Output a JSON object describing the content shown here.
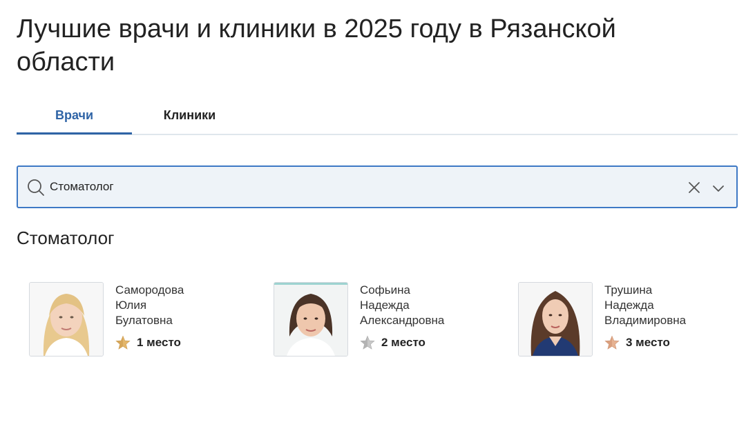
{
  "page": {
    "title": "Лучшие врачи и клиники в 2025 году в Рязанской области"
  },
  "tabs": [
    {
      "label": "Врачи",
      "active": true
    },
    {
      "label": "Клиники",
      "active": false
    }
  ],
  "search": {
    "value": "Стоматолог",
    "icons": {
      "search": "search-icon",
      "clear": "close-icon",
      "expand": "chevron-down-icon"
    }
  },
  "section": {
    "title": "Стоматолог"
  },
  "doctors": [
    {
      "last_name": "Самородова",
      "first_name": "Юлия",
      "patronymic": "Булатовна",
      "rank": "1 место",
      "medal_color": "#e3b66b"
    },
    {
      "last_name": "Софьина",
      "first_name": "Надежда",
      "patronymic": "Александровна",
      "rank": "2 место",
      "medal_color": "#bdbdbd"
    },
    {
      "last_name": "Трушина",
      "first_name": "Надежда",
      "patronymic": "Владимировна",
      "rank": "3 место",
      "medal_color": "#e6b292"
    }
  ],
  "colors": {
    "accent": "#2f64a6",
    "search_border": "#3d78c5",
    "search_bg": "#eef3f8"
  }
}
